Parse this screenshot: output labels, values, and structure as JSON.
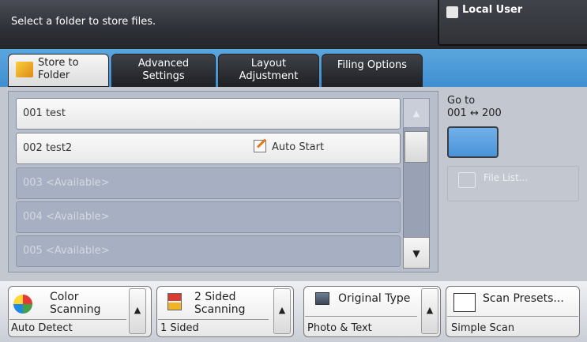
{
  "header": {
    "instruction": "Select a folder to store files.",
    "user": "Local User"
  },
  "tabs": [
    {
      "label_line1": "Store to",
      "label_line2": "Folder"
    },
    {
      "label_line1": "Advanced",
      "label_line2": "Settings"
    },
    {
      "label_line1": "Layout",
      "label_line2": "Adjustment"
    },
    {
      "label_line1": "Filing Options",
      "label_line2": ""
    }
  ],
  "folders": [
    {
      "label": "001  test"
    },
    {
      "label": "002  test2"
    },
    {
      "label": "003  <Available>"
    },
    {
      "label": "004  <Available>"
    },
    {
      "label": "005  <Available>"
    }
  ],
  "auto_start": "Auto Start",
  "goto": {
    "label": "Go to",
    "range": "001 ↔ 200"
  },
  "file_list": "File List...",
  "features": {
    "color": {
      "title_line1": "Color",
      "title_line2": "Scanning",
      "value": "Auto Detect"
    },
    "sided": {
      "title_line1": "2 Sided",
      "title_line2": "Scanning",
      "value": "1 Sided"
    },
    "original": {
      "title": "Original Type",
      "value": "Photo & Text"
    },
    "presets": {
      "title": "Scan Presets...",
      "value": "Simple Scan"
    }
  },
  "glyphs": {
    "up": "▲",
    "down": "▼"
  }
}
